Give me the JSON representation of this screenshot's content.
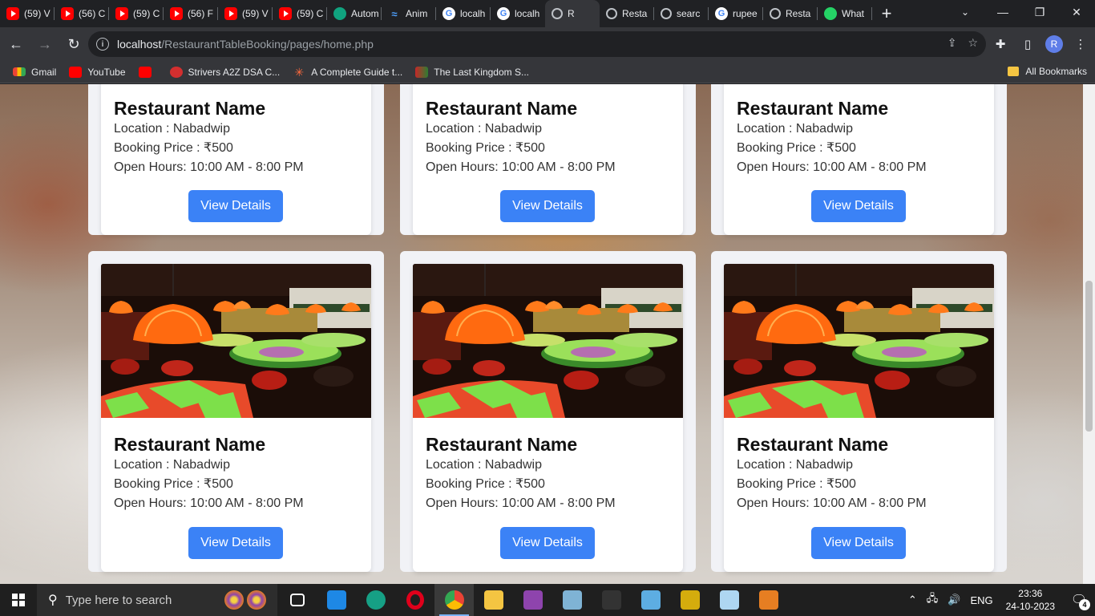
{
  "tabs": [
    {
      "title": "(59) V",
      "icon": "youtube-icon"
    },
    {
      "title": "(56) C",
      "icon": "youtube-icon"
    },
    {
      "title": "(59) C",
      "icon": "youtube-icon"
    },
    {
      "title": "(56) F",
      "icon": "youtube-icon"
    },
    {
      "title": "(59) V",
      "icon": "youtube-icon"
    },
    {
      "title": "(59) C",
      "icon": "youtube-icon"
    },
    {
      "title": "Autom",
      "icon": "chatgpt-icon"
    },
    {
      "title": "Anim",
      "icon": "animation-icon"
    },
    {
      "title": "localh",
      "icon": "google-icon"
    },
    {
      "title": "localh",
      "icon": "google-icon"
    },
    {
      "title": "R",
      "icon": "globe-icon"
    },
    {
      "title": "Resta",
      "icon": "globe-icon"
    },
    {
      "title": "searc",
      "icon": "globe-icon"
    },
    {
      "title": "rupee",
      "icon": "google-icon"
    },
    {
      "title": "Resta",
      "icon": "globe-icon"
    },
    {
      "title": "What",
      "icon": "whatsapp-icon"
    }
  ],
  "address": {
    "host": "localhost",
    "path": "/RestaurantTableBooking/pages/home.php"
  },
  "profile_initial": "R",
  "bookmarks": [
    {
      "label": "Gmail",
      "icon": "gmail-icon"
    },
    {
      "label": "YouTube",
      "icon": "youtube-icon"
    },
    {
      "label": "",
      "icon": "youtube-icon"
    },
    {
      "label": "Strivers A2Z DSA C...",
      "icon": "tuf-icon"
    },
    {
      "label": "A Complete Guide t...",
      "icon": "star-icon"
    },
    {
      "label": "The Last Kingdom S...",
      "icon": "tv-icon"
    }
  ],
  "all_bookmarks": "All Bookmarks",
  "restaurants": [
    {
      "name": "Restaurant Name",
      "location": "Location : Nabadwip",
      "price": "Booking Price : ₹500",
      "hours": "Open Hours: 10:00 AM - 8:00 PM",
      "button": "View Details"
    },
    {
      "name": "Restaurant Name",
      "location": "Location : Nabadwip",
      "price": "Booking Price : ₹500",
      "hours": "Open Hours: 10:00 AM - 8:00 PM",
      "button": "View Details"
    },
    {
      "name": "Restaurant Name",
      "location": "Location : Nabadwip",
      "price": "Booking Price : ₹500",
      "hours": "Open Hours: 10:00 AM - 8:00 PM",
      "button": "View Details"
    },
    {
      "name": "Restaurant Name",
      "location": "Location : Nabadwip",
      "price": "Booking Price : ₹500",
      "hours": "Open Hours: 10:00 AM - 8:00 PM",
      "button": "View Details"
    },
    {
      "name": "Restaurant Name",
      "location": "Location : Nabadwip",
      "price": "Booking Price : ₹500",
      "hours": "Open Hours: 10:00 AM - 8:00 PM",
      "button": "View Details"
    },
    {
      "name": "Restaurant Name",
      "location": "Location : Nabadwip",
      "price": "Booking Price : ₹500",
      "hours": "Open Hours: 10:00 AM - 8:00 PM",
      "button": "View Details"
    }
  ],
  "colors": {
    "accent_button": "#3b82f6",
    "chrome_dark": "#202124",
    "chrome_toolbar": "#35363a"
  },
  "taskbar": {
    "search_placeholder": "Type here to search",
    "apps": [
      "task-view-icon",
      "vscode-icon",
      "edge-icon",
      "opera-icon",
      "chrome-icon",
      "file-explorer-icon",
      "winrar-icon",
      "notepad-icon",
      "terminal-icon",
      "control-panel-icon",
      "folder-app-icon",
      "mysql-workbench-icon",
      "xampp-icon"
    ],
    "language": "ENG",
    "time": "23:36",
    "date": "24-10-2023",
    "notification_count": "4"
  }
}
